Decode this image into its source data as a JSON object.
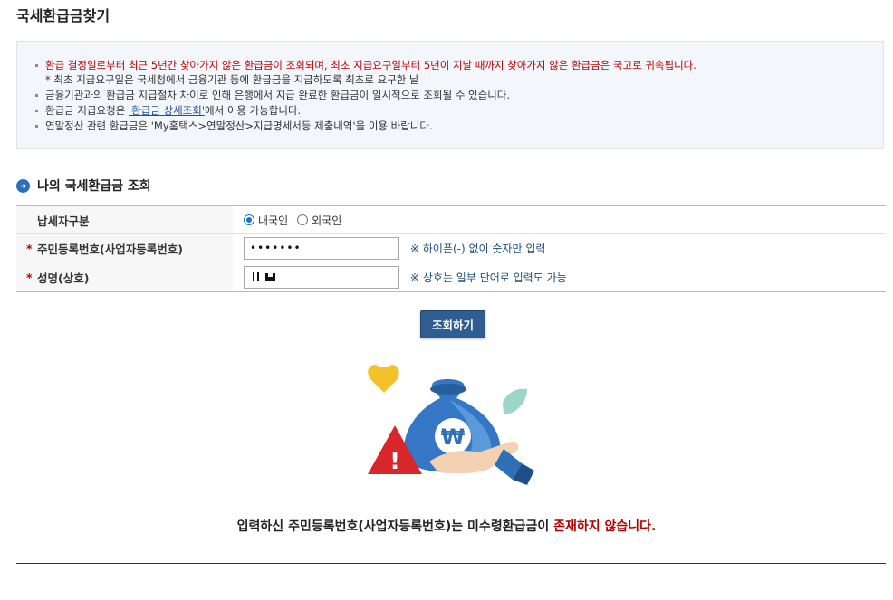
{
  "page_title": "국세환급금찾기",
  "notice": {
    "line1": "환급 결정일로부터 최근 5년간 찾아가지 않은 환급금이 조회되며, 최초 지급요구일부터 5년이 지날 때까지 찾아가지 않은 환급금은 국고로 귀속됩니다.",
    "line1_sub": "* 최초 지급요구일은 국세청에서 금융기관 등에 환급금을 지급하도록 최초로 요구한 날",
    "line2": "금융기관과의 환급금 지급절차 차이로 인해 은행에서 지급 완료한 환급금이 일시적으로 조회될 수 있습니다.",
    "line3_pre": "환급금 지급요청은 ",
    "line3_link": "'환급금 상세조회'",
    "line3_post": "에서 이용 가능합니다.",
    "line4": "연말정산 관련 환급금은 'My홈택스>연말정산>지급명세서등 제출내역'을 이용 바랍니다."
  },
  "section_title": "나의 국세환급금 조회",
  "form": {
    "taxpayer_type": {
      "label": "납세자구분",
      "options": [
        "내국인",
        "외국인"
      ],
      "selected": "내국인"
    },
    "rrn": {
      "required_mark": "*",
      "label": "주민등록번호(사업자등록번호)",
      "value": "•••••••",
      "hint": "※ 하이픈(-) 없이 숫자만 입력"
    },
    "name": {
      "required_mark": "*",
      "label": "성명(상호)",
      "value": "",
      "hint": "※ 상호는 일부 단어로 입력도 가능"
    }
  },
  "search_button": "조회하기",
  "illustration": {
    "icon": "money-bag-with-won-icon",
    "won_symbol": "₩",
    "warning_symbol": "!"
  },
  "result": {
    "message_pre": "입력하신 주민등록번호(사업자등록번호)는 미수령환급금이 ",
    "message_red": "존재하지 않습니다."
  },
  "colors": {
    "accent": "#2f5d91",
    "alert_red": "#c00000",
    "hint_blue": "#1d4e7c"
  }
}
